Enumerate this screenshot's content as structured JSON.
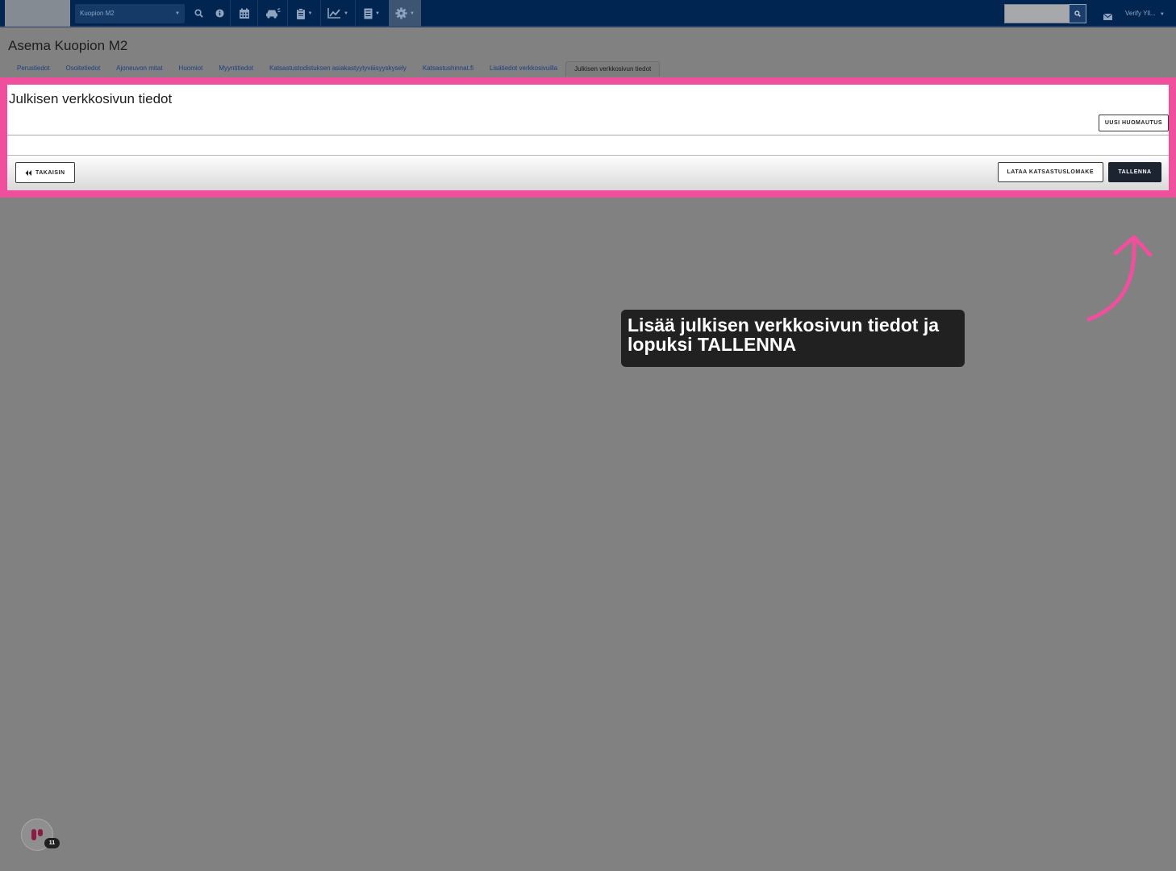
{
  "navbar": {
    "station_select": "Kuopion M2",
    "user_menu": "Verify Yll...",
    "search_placeholder": "",
    "icons": [
      "search-icon",
      "info-icon",
      "calendar-icon",
      "car-icon",
      "clipboard-icon",
      "chart-icon",
      "document-icon",
      "gear-icon"
    ]
  },
  "page": {
    "title": "Asema Kuopion M2"
  },
  "tabs": [
    {
      "label": "Perustiedot"
    },
    {
      "label": "Osoitetiedot"
    },
    {
      "label": "Ajoneuvon mitat"
    },
    {
      "label": "Huomiot"
    },
    {
      "label": "Myyntitiedot"
    },
    {
      "label": "Katsastustodistuksen asiakastyytyväisyyskysely"
    },
    {
      "label": "Katsastushinnat.fi"
    },
    {
      "label": "Lisätiedot verkkosivuilla"
    },
    {
      "label": "Julkisen verkkosivun tiedot"
    }
  ],
  "panel": {
    "title": "Julkisen verkkosivun tiedot",
    "new_note_label": "UUSI HUOMAUTUS",
    "back_label": "TAKAISIN",
    "download_label": "LATAA KATSASTUSLOMAKE",
    "save_label": "TALLENNA"
  },
  "tooltip": {
    "text": "Lisää julkisen verkkosivun tiedot ja lopuksi TALLENNA"
  },
  "helper": {
    "count": "11"
  },
  "colors": {
    "navbar": "#012551",
    "highlight": "#ef4f9c",
    "save_button": "#1c2331",
    "overlay": "#818181"
  }
}
